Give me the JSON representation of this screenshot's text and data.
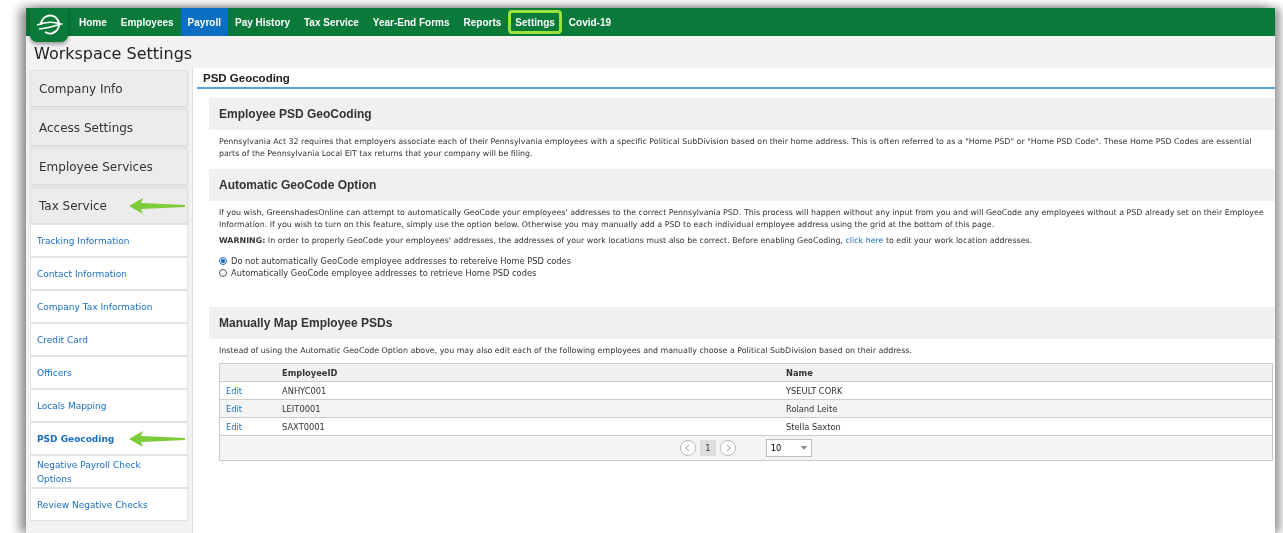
{
  "nav": {
    "items": [
      {
        "label": "Home",
        "selected": false,
        "highlighted": false
      },
      {
        "label": "Employees",
        "selected": false,
        "highlighted": false
      },
      {
        "label": "Payroll",
        "selected": true,
        "highlighted": false
      },
      {
        "label": "Pay History",
        "selected": false,
        "highlighted": false
      },
      {
        "label": "Tax Service",
        "selected": false,
        "highlighted": false
      },
      {
        "label": "Year-End Forms",
        "selected": false,
        "highlighted": false
      },
      {
        "label": "Reports",
        "selected": false,
        "highlighted": false
      },
      {
        "label": "Settings",
        "selected": false,
        "highlighted": true
      },
      {
        "label": "Covid-19",
        "selected": false,
        "highlighted": false
      }
    ]
  },
  "page_title": "Workspace Settings",
  "sidebar": {
    "items": [
      {
        "kind": "header",
        "label": "Company Info",
        "arrow": false
      },
      {
        "kind": "header",
        "label": "Access Settings",
        "arrow": false
      },
      {
        "kind": "header",
        "label": "Employee Services",
        "arrow": false
      },
      {
        "kind": "header",
        "label": "Tax Service",
        "arrow": true
      },
      {
        "kind": "link",
        "label": "Tracking Information",
        "selected": false,
        "arrow": false
      },
      {
        "kind": "link",
        "label": "Contact Information",
        "selected": false,
        "arrow": false
      },
      {
        "kind": "link",
        "label": "Company Tax Information",
        "selected": false,
        "arrow": false
      },
      {
        "kind": "link",
        "label": "Credit Card",
        "selected": false,
        "arrow": false
      },
      {
        "kind": "link",
        "label": "Officers",
        "selected": false,
        "arrow": false
      },
      {
        "kind": "link",
        "label": "Locals Mapping",
        "selected": false,
        "arrow": false
      },
      {
        "kind": "link",
        "label": "PSD Geocoding",
        "selected": true,
        "arrow": true
      },
      {
        "kind": "link",
        "label": "Negative Payroll Check Options",
        "selected": false,
        "arrow": false
      },
      {
        "kind": "link",
        "label": "Review Negative Checks",
        "selected": false,
        "arrow": false
      }
    ]
  },
  "content": {
    "title": "PSD Geocoding",
    "sections": [
      {
        "heading": "Employee PSD GeoCoding",
        "paragraphs": [
          "Pennsylvania Act 32 requires that employers associate each of their Pennsylvania employees with a specific Political SubDivision based on their home address. This is often referred to as a \"Home PSD\" or \"Home PSD Code\". These Home PSD Codes are essential parts of the Pennsylvania Local EIT tax returns that your company will be filing."
        ]
      },
      {
        "heading": "Automatic GeoCode Option",
        "paragraphs": [
          "If you wish, GreenshadesOnline can attempt to automatically GeoCode your employees' addresses to the correct Pennsylvania PSD. This process will happen without any input from you and will GeoCode any employees without a PSD already set on their Employee Information. If you wish to turn on this feature, simply use the option below. Otherwise you may manually add a PSD to each individual employee address using the grid at the bottom of this page."
        ],
        "warning": {
          "before": "**WARNING:** In order to properly GeoCode your employees' addresses, the addresses of your work locations must also be correct. Before enabling GeoCoding,",
          "link": "click here",
          "after": "to edit your work location addresses."
        },
        "options": [
          {
            "label": "Do not automatically GeoCode employee addresses to retereive Home PSD codes",
            "selected": true
          },
          {
            "label": "Automatically GeoCode employee addresses to retrieve Home PSD codes",
            "selected": false
          }
        ]
      },
      {
        "heading": "Manually Map Employee PSDs",
        "paragraphs": [
          "Instead of using the Automatic GeoCode Option above, you may also edit each of the following employees and manually choose a Political SubDivision based on their address."
        ],
        "table": {
          "columns": [
            "EmployeeID",
            "Name"
          ],
          "rows": [
            {
              "action": "Edit",
              "id": "ANHYC001",
              "name": "YSEULT CORK"
            },
            {
              "action": "Edit",
              "id": "LEIT0001",
              "name": "Roland Leite"
            },
            {
              "action": "Edit",
              "id": "SAXT0001",
              "name": "Stella Saxton"
            }
          ],
          "pager": {
            "page": "1",
            "page_size": "10"
          }
        }
      }
    ]
  }
}
